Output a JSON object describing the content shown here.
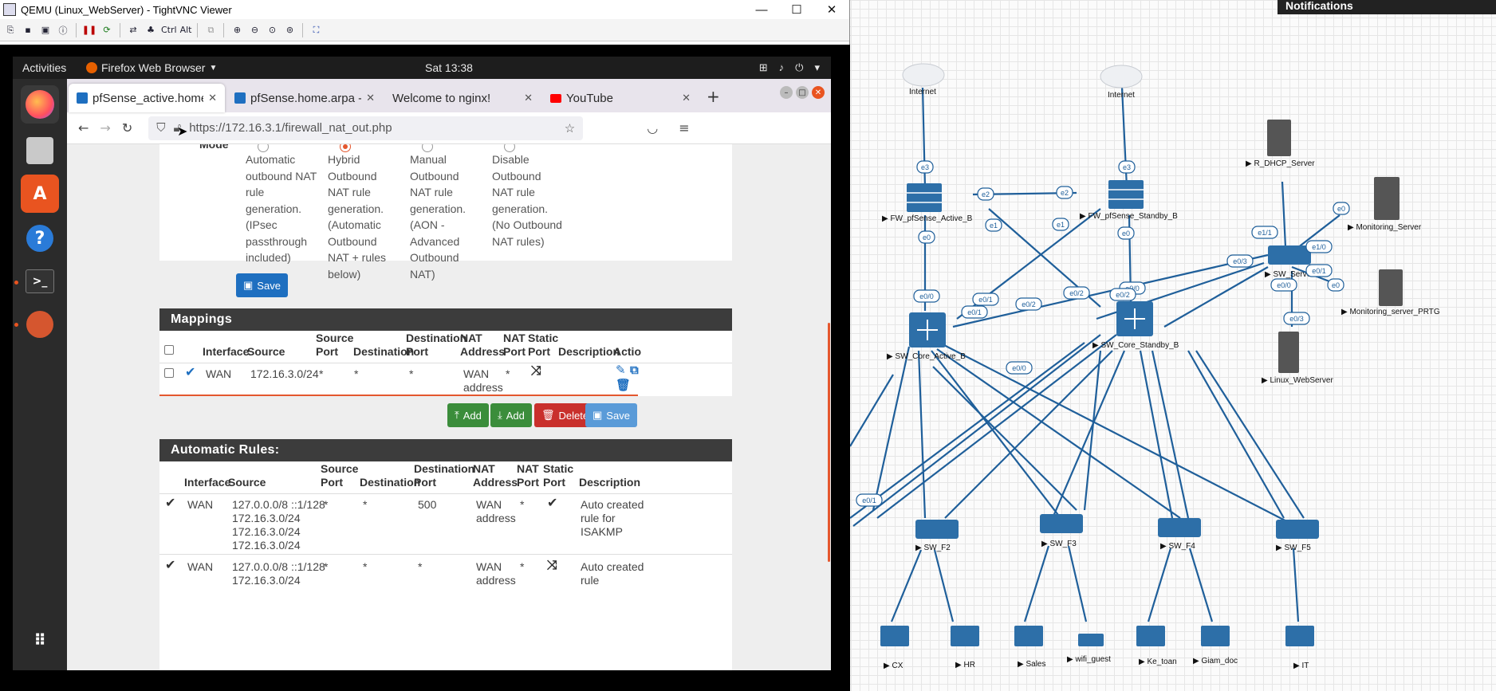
{
  "notifications_header": "Notifications",
  "vnc": {
    "title": "QEMU (Linux_WebServer) - TightVNC Viewer",
    "toolbar_ctrl": "Ctrl",
    "toolbar_alt": "Alt"
  },
  "ubuntu": {
    "activities": "Activities",
    "app_name": "Firefox Web Browser",
    "clock": "Sat 13:38"
  },
  "browser": {
    "tabs": [
      {
        "label": "pfSense_active.home",
        "active": true
      },
      {
        "label": "pfSense.home.arpa - F",
        "active": false
      },
      {
        "label": "Welcome to nginx!",
        "active": false
      },
      {
        "label": "YouTube",
        "active": false
      }
    ],
    "url": "https://172.16.3.1/firewall_nat_out.php"
  },
  "mode": {
    "label": "Mode",
    "options": [
      {
        "text": "Automatic outbound NAT rule generation. (IPsec passthrough included)",
        "lines": [
          "Automatic",
          "outbound NAT",
          "rule",
          "generation.",
          "(IPsec",
          "passthrough",
          "included)"
        ],
        "selected": false
      },
      {
        "text": "Hybrid Outbound NAT rule generation. (Automatic Outbound NAT + rules below)",
        "lines": [
          "Hybrid",
          "Outbound",
          "NAT rule",
          "generation.",
          "(Automatic",
          "Outbound",
          "NAT + rules",
          "below)"
        ],
        "selected": true
      },
      {
        "text": "Manual Outbound NAT rule generation. (AON - Advanced Outbound NAT)",
        "lines": [
          "Manual",
          "Outbound",
          "NAT rule",
          "generation.",
          "(AON -",
          "Advanced",
          "Outbound",
          "NAT)"
        ],
        "selected": false
      },
      {
        "text": "Disable Outbound NAT rule generation. (No Outbound NAT rules)",
        "lines": [
          "Disable",
          "Outbound",
          "NAT rule",
          "generation.",
          "(No Outbound",
          "NAT rules)"
        ],
        "selected": false
      }
    ],
    "save_label": "Save"
  },
  "mappings": {
    "title": "Mappings",
    "headers": [
      "Interface",
      "Source",
      "Source Port",
      "Destination",
      "Destination Port",
      "NAT Address",
      "NAT Port",
      "Static Port",
      "Description",
      "Actions"
    ],
    "header_lines": {
      "source_port": [
        "Source",
        "Port"
      ],
      "destination_port": [
        "Destination",
        "Port"
      ],
      "nat_address": [
        "NAT",
        "Address"
      ],
      "nat_port": [
        "NAT",
        "Port"
      ],
      "static_port": [
        "Static",
        "Port"
      ]
    },
    "actions_visible": "Actio",
    "row": {
      "interface": "WAN",
      "source": "172.16.3.0/24",
      "source_port": "*",
      "destination": "*",
      "destination_port": "*",
      "nat_address_lines": [
        "WAN",
        "address"
      ],
      "nat_port": "*"
    },
    "buttons": {
      "add_top": "Add",
      "add_bottom": "Add",
      "delete": "Delete",
      "save": "Save"
    }
  },
  "auto_rules": {
    "title": "Automatic Rules:",
    "headers": {
      "interface": "Interface",
      "source": "Source",
      "source_port": [
        "Source",
        "Port"
      ],
      "destination": "Destination",
      "destination_port": [
        "Destination",
        "Port"
      ],
      "nat_address": [
        "NAT",
        "Address"
      ],
      "nat_port": [
        "NAT",
        "Port"
      ],
      "static_port": [
        "Static",
        "Port"
      ],
      "description": "Description"
    },
    "rows": [
      {
        "interface": "WAN",
        "source_lines": [
          "127.0.0.0/8 ::1/128",
          "172.16.3.0/24",
          "172.16.3.0/24",
          "172.16.3.0/24"
        ],
        "source_port": "*",
        "destination": "*",
        "destination_port": "500",
        "nat_address_lines": [
          "WAN",
          "address"
        ],
        "nat_port": "*",
        "description_lines": [
          "Auto created",
          "rule for",
          "ISAKMP"
        ]
      },
      {
        "interface": "WAN",
        "source_lines": [
          "127.0.0.0/8 ::1/128",
          "172.16.3.0/24"
        ],
        "source_port": "*",
        "destination": "*",
        "destination_port": "*",
        "nat_address_lines": [
          "WAN",
          "address"
        ],
        "nat_port": "*",
        "description_lines": [
          "Auto created",
          "rule"
        ]
      }
    ]
  },
  "topology": {
    "clouds": [
      "Internet",
      "Internet"
    ],
    "firewalls": [
      "FW_pfSense_Active_B",
      "FW_pfSense_Standby_B"
    ],
    "core_switches": [
      "SW_Core_Active_B",
      "SW_Core_Standby_B"
    ],
    "servers": [
      "R_DHCP_Server",
      "Monitoring_Server",
      "Monitoring_server_PRTG",
      "Linux_WebServer"
    ],
    "server_switch": "SW_Server",
    "floor_switches": [
      "SW_F2",
      "SW_F3",
      "SW_F4",
      "SW_F5"
    ],
    "hosts": [
      "CX",
      "HR",
      "Sales",
      "wifi_guest",
      "Ke_toan",
      "Giam_doc",
      "IT"
    ],
    "ports": [
      "e3",
      "e3",
      "e2",
      "e2",
      "e1",
      "e1",
      "e0",
      "e0",
      "e0/0",
      "e0/0",
      "e0/1",
      "e0/2",
      "e0/1",
      "e0/0",
      "e0/2",
      "e0/3",
      "e0/2",
      "e0/0",
      "e1/1",
      "e1/0",
      "e0/1",
      "e0",
      "e0",
      "e0/3",
      "e0/1"
    ]
  }
}
